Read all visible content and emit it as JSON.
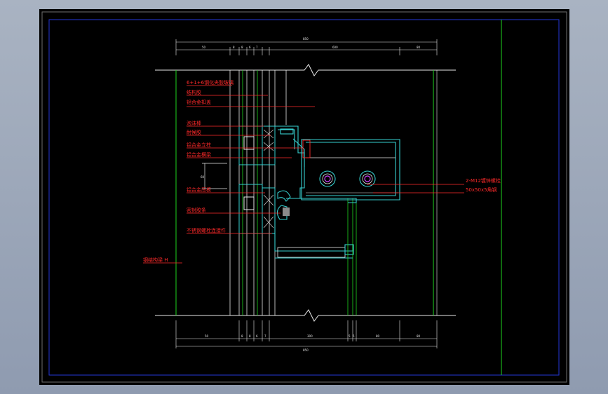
{
  "viewport": {
    "background": "#000000"
  },
  "colors": {
    "frame": "#6f6f6f",
    "border": "#2438d8",
    "grid_line": "#1ed51e",
    "profile": "#36d0d0",
    "annotation": "#ff2a2a",
    "dimension": "#e8e8e8",
    "pipe": "#d040ff"
  },
  "annotations": {
    "left": [
      "6+1+6钢化夹胶玻璃",
      "结构胶",
      "铝合金扣盖",
      "泡沫棒",
      "耐候胶",
      "铝合金立柱",
      "铝合金横梁",
      "铝合金压板",
      "密封胶条",
      "不锈钢螺栓连接件"
    ],
    "right": [
      "2-M12镀锌螺栓",
      "50x50x5角钢"
    ],
    "bottom_left": "钢结构梁 H"
  },
  "dimensions": {
    "top_total": "850",
    "top_segments": [
      "50",
      "8",
      "8",
      "6",
      "7",
      "600",
      "80"
    ],
    "bottom_total": "850",
    "bottom_segments": [
      "50",
      "8",
      "8",
      "6",
      "7",
      "300",
      "5",
      "5",
      "80",
      "80"
    ],
    "side_offset": "60"
  }
}
